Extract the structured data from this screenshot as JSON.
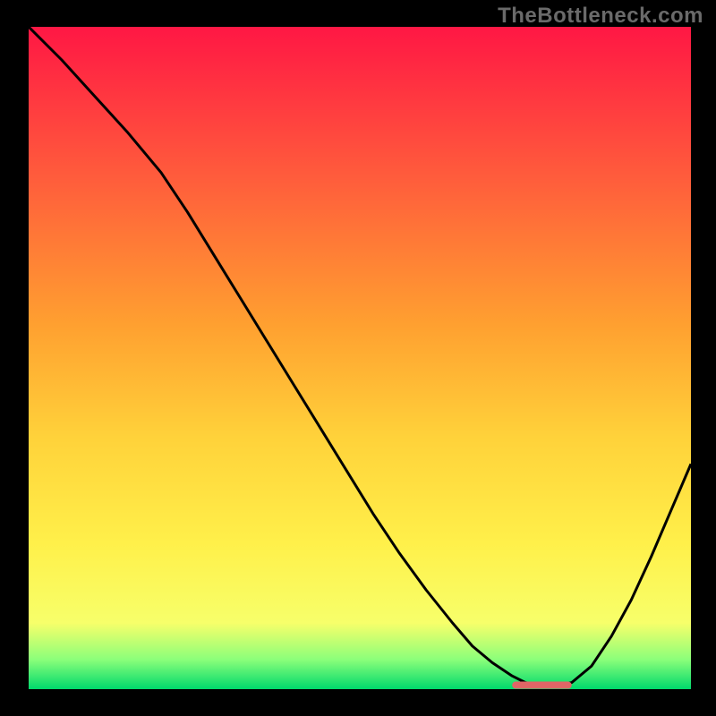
{
  "watermark": "TheBottleneck.com",
  "colors": {
    "background": "#000000",
    "curve": "#000000",
    "marker": "#e06666",
    "grad_top": "#ff1744",
    "grad_upper": "#ff5a3c",
    "grad_mid_high": "#ffa030",
    "grad_mid": "#ffd23a",
    "grad_mid_low": "#fff04a",
    "grad_low": "#f7ff6a",
    "grad_green_light": "#8cff7a",
    "grad_green": "#00d96c"
  },
  "chart_data": {
    "type": "line",
    "title": "",
    "xlabel": "",
    "ylabel": "",
    "xlim": [
      0,
      100
    ],
    "ylim": [
      0,
      100
    ],
    "x": [
      0,
      5,
      10,
      15,
      20,
      24,
      28,
      32,
      36,
      40,
      44,
      48,
      52,
      56,
      60,
      64,
      67,
      70,
      73,
      75,
      77,
      80,
      82,
      85,
      88,
      91,
      94,
      97,
      100
    ],
    "values": [
      100,
      95,
      89.5,
      84,
      78,
      72,
      65.5,
      59,
      52.5,
      46,
      39.5,
      33,
      26.5,
      20.5,
      15,
      10,
      6.5,
      4,
      2,
      1,
      0.6,
      0.5,
      1,
      3.5,
      8,
      13.5,
      20,
      27,
      34
    ],
    "flat_region": {
      "x_range": [
        73,
        82
      ],
      "y": 0.6
    },
    "note": "axes unlabeled in source; x interpreted as horizontal percent position and values as height percent of plot area"
  }
}
